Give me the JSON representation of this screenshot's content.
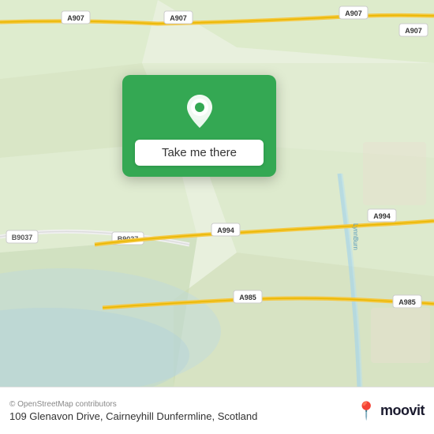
{
  "map": {
    "alt": "Map of Cairneyhill Dunfermline area",
    "road_labels": [
      "A907",
      "A907",
      "A907",
      "A907",
      "A994",
      "A994",
      "A985",
      "A985",
      "B9037",
      "B9037"
    ]
  },
  "location_card": {
    "button_label": "Take me there",
    "pin_icon": "location-pin-icon",
    "bg_color": "#34a853"
  },
  "footer": {
    "copyright": "© OpenStreetMap contributors",
    "address": "109 Glenavon Drive, Cairneyhill Dunfermline, Scotland",
    "moovit_pin_symbol": "📍",
    "moovit_wordmark": "moovit"
  }
}
